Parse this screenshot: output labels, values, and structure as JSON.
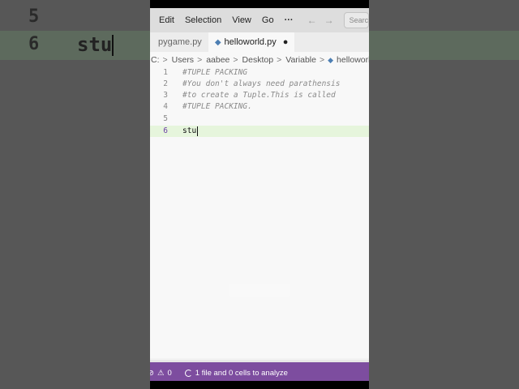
{
  "background": {
    "line_numbers": [
      "5",
      "6"
    ],
    "current_code": "stu"
  },
  "menu": {
    "items": [
      "Edit",
      "Selection",
      "View",
      "Go"
    ],
    "more_label": "···",
    "back_icon": "arrow-left-icon",
    "forward_icon": "arrow-right-icon",
    "search_placeholder": "Search"
  },
  "tabs": [
    {
      "label": "pygame.py",
      "active": false
    },
    {
      "label": "helloworld.py",
      "active": true,
      "modified": true
    }
  ],
  "tab_modified_marker": "●",
  "breadcrumb": {
    "parts": [
      "C:",
      "Users",
      "aabee",
      "Desktop",
      "Variable"
    ],
    "file": "helloworld.py",
    "separator": ">"
  },
  "editor": {
    "lines": [
      {
        "number": "1",
        "text": "#TUPLE PACKING",
        "type": "comment"
      },
      {
        "number": "2",
        "text": "#You don't always need parathensis",
        "type": "comment"
      },
      {
        "number": "3",
        "text": "#to create a Tuple.This is called",
        "type": "comment"
      },
      {
        "number": "4",
        "text": "#TUPLE PACKING.",
        "type": "comment"
      },
      {
        "number": "5",
        "text": "",
        "type": "plain"
      },
      {
        "number": "6",
        "text": "stu",
        "type": "plain",
        "current": true
      }
    ]
  },
  "status": {
    "problems_count": "0",
    "analysis_text": "1 file and 0 cells to analyze"
  },
  "colors": {
    "status_bar": "#7d4d9f",
    "current_line": "#e6f5dc",
    "comment": "#8a8a8a",
    "python_icon": "#4d7fb3"
  }
}
